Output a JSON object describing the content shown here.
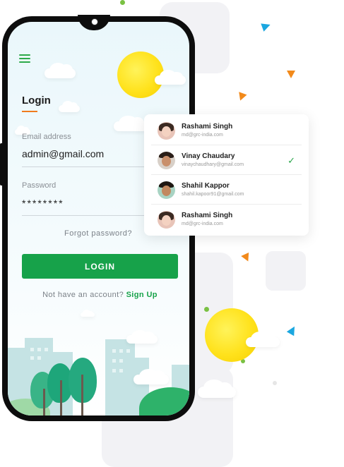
{
  "login": {
    "title": "Login",
    "email_label": "Email address",
    "email_value": "admin@gmail.com",
    "password_label": "Password",
    "password_value": "********",
    "forgot_label": "Forgot  password?",
    "login_button": "LOGIN",
    "signup_prompt": "Not have an account?",
    "signup_link": "Sign Up"
  },
  "users": [
    {
      "name": "Rashami Singh",
      "email": "md@grc-india.com",
      "selected": false
    },
    {
      "name": "Vinay Chaudary",
      "email": "vinaychaudhary@gmail.com",
      "selected": true
    },
    {
      "name": "Shahil Kappor",
      "email": "shahil.kapoor91@gmail.com",
      "selected": false
    },
    {
      "name": "Rashami Singh",
      "email": "md@grc-india.com",
      "selected": false
    }
  ],
  "icons": {
    "menu": "hamburger-menu-icon",
    "check": "checkmark-icon"
  },
  "colors": {
    "primary_green": "#17a24a",
    "accent_orange": "#f07b1d",
    "accent_blue": "#1ba7e0",
    "sun_yellow": "#ffe21c"
  }
}
